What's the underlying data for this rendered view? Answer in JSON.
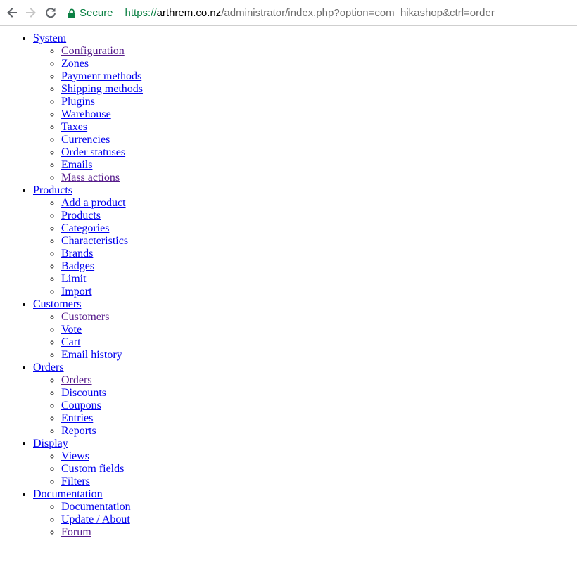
{
  "browser": {
    "secure_label": "Secure",
    "url_scheme": "https://",
    "url_host": "arthrem.co.nz",
    "url_path": "/administrator/index.php?option=com_hikashop&ctrl=order",
    "colors": {
      "secure": "#0b8043",
      "link": "#0000ee",
      "visited": "#551a8b"
    }
  },
  "menu": [
    {
      "label": "System",
      "items": [
        "Configuration",
        "Zones",
        "Payment methods",
        "Shipping methods",
        "Plugins",
        "Warehouse",
        "Taxes",
        "Currencies",
        "Order statuses",
        "Emails",
        "Mass actions"
      ]
    },
    {
      "label": "Products",
      "items": [
        "Add a product",
        "Products",
        "Categories",
        "Characteristics",
        "Brands",
        "Badges",
        "Limit",
        "Import"
      ]
    },
    {
      "label": "Customers",
      "items": [
        "Customers",
        "Vote",
        "Cart",
        "Email history"
      ]
    },
    {
      "label": "Orders",
      "items": [
        "Orders",
        "Discounts",
        "Coupons",
        "Entries",
        "Reports"
      ]
    },
    {
      "label": "Display",
      "items": [
        "Views",
        "Custom fields",
        "Filters"
      ]
    },
    {
      "label": "Documentation",
      "items": [
        "Documentation",
        "Update / About",
        "Forum"
      ]
    }
  ]
}
